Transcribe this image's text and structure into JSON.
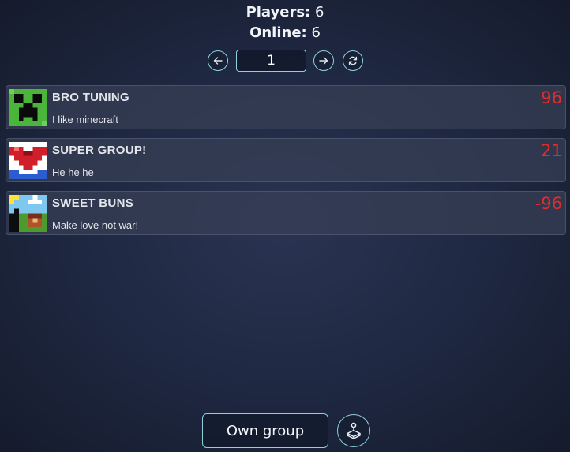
{
  "header": {
    "players_label": "Players:",
    "players_count": "6",
    "online_label": "Online:",
    "online_count": "6"
  },
  "pager": {
    "page_value": "1",
    "prev_icon": "arrow-left-icon",
    "next_icon": "arrow-right-icon",
    "refresh_icon": "refresh-icon"
  },
  "groups": [
    {
      "name": "BRO TUNING",
      "description": "I like minecraft",
      "score": "96",
      "icon": "creeper-face"
    },
    {
      "name": "SUPER GROUP!",
      "description": "He he he",
      "score": "21",
      "icon": "pixel-heart"
    },
    {
      "name": "SWEET BUNS",
      "description": "Make love not war!",
      "score": "-96",
      "icon": "pixel-landscape"
    }
  ],
  "footer": {
    "own_group_label": "Own group",
    "joystick_icon": "joystick-icon"
  },
  "colors": {
    "accent_outline": "#8fd0dc",
    "score": "#e22c2c"
  }
}
